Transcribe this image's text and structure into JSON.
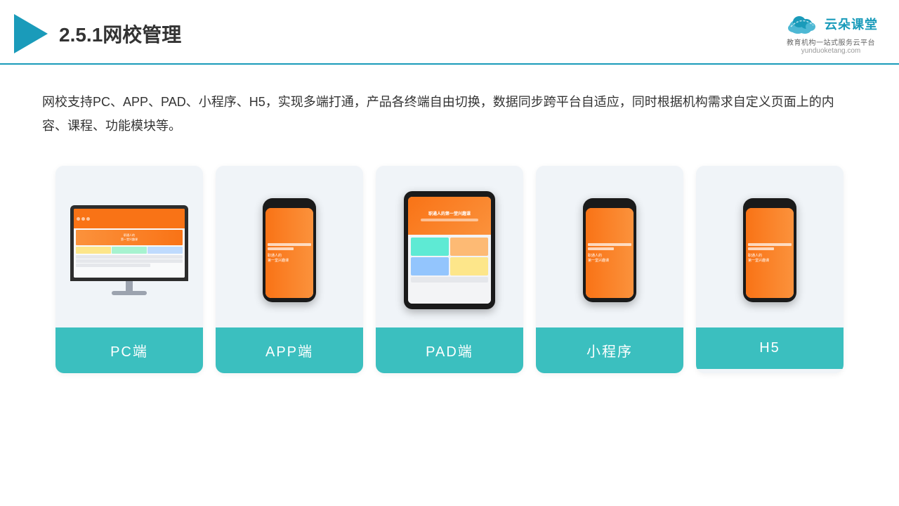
{
  "header": {
    "title": "2.5.1网校管理",
    "logo_name": "云朵课堂",
    "logo_url": "yunduoketang.com",
    "logo_tagline": "教育机构一站式服务云平台"
  },
  "description": "网校支持PC、APP、PAD、小程序、H5，实现多端打通，产品各终端自由切换，数据同步跨平台自适应，同时根据机构需求自定义页面上的内容、课程、功能模块等。",
  "cards": [
    {
      "id": "pc",
      "label": "PC端"
    },
    {
      "id": "app",
      "label": "APP端"
    },
    {
      "id": "pad",
      "label": "PAD端"
    },
    {
      "id": "miniapp",
      "label": "小程序"
    },
    {
      "id": "h5",
      "label": "H5"
    }
  ]
}
